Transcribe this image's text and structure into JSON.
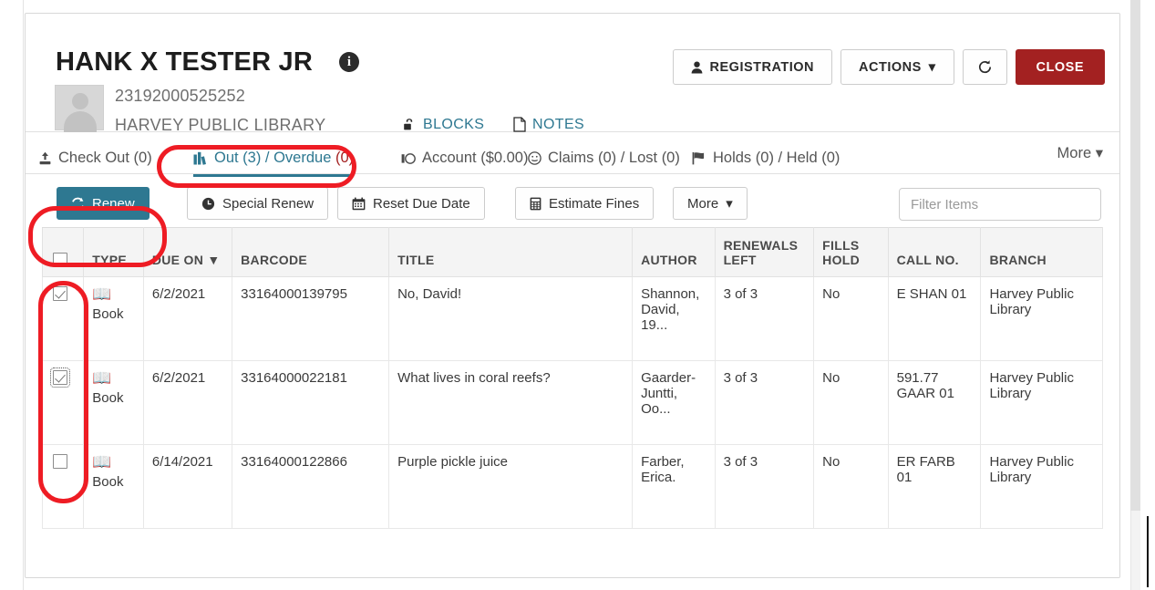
{
  "patron": {
    "name": "HANK X TESTER JR",
    "info_icon": "info-icon",
    "info_glyph": "i",
    "barcode": "23192000525252",
    "library": "HARVEY PUBLIC LIBRARY",
    "blocks_label": "BLOCKS",
    "notes_label": "NOTES"
  },
  "header_buttons": {
    "registration": "REGISTRATION",
    "actions": "ACTIONS",
    "actions_caret": "▾",
    "refresh_icon": "refresh-icon",
    "close": "CLOSE"
  },
  "tabs": [
    {
      "label": "Check Out (0)",
      "icon": "check-out-icon",
      "active": false
    },
    {
      "label": "Out (3) / Overdue (0)",
      "prefix": "Out (3) / Overdue ",
      "suffix": "(0)",
      "icon": "books-icon",
      "active": true
    },
    {
      "label": "Account ($0.00)",
      "icon": "coin-icon",
      "active": false
    },
    {
      "label": "Claims (0) / Lost (0)",
      "icon": "face-icon",
      "active": false
    },
    {
      "label": "Holds (0) / Held (0)",
      "icon": "flag-icon",
      "active": false
    }
  ],
  "tab_more": "More ▾",
  "toolbar": {
    "renew": "Renew",
    "special_renew": "Special Renew",
    "reset_due_date": "Reset Due Date",
    "estimate_fines": "Estimate Fines",
    "more": "More",
    "more_caret": "▾",
    "filter_placeholder": "Filter Items",
    "filter_value": ""
  },
  "table": {
    "columns": [
      {
        "key": "select",
        "label": "",
        "header_checkbox": true
      },
      {
        "key": "type",
        "label": "TYPE"
      },
      {
        "key": "due_on",
        "label": "DUE ON",
        "sorted": true,
        "sort_arrow": "▼"
      },
      {
        "key": "barcode",
        "label": "BARCODE"
      },
      {
        "key": "title",
        "label": "TITLE"
      },
      {
        "key": "author",
        "label": "AUTHOR"
      },
      {
        "key": "renewals",
        "label": "RENEWALS LEFT"
      },
      {
        "key": "fills",
        "label": "FILLS HOLD"
      },
      {
        "key": "callno",
        "label": "CALL NO."
      },
      {
        "key": "branch",
        "label": "BRANCH"
      }
    ],
    "rows": [
      {
        "checked": true,
        "focused": false,
        "type": "Book",
        "type_icon": "book-icon",
        "due_on": "6/2/2021",
        "barcode": "33164000139795",
        "title": "No, David!",
        "author": "Shannon, David, 19...",
        "renewals": "3 of 3",
        "fills": "No",
        "callno": "E SHAN 01",
        "branch": "Harvey Public Library"
      },
      {
        "checked": true,
        "focused": true,
        "type": "Book",
        "type_icon": "book-icon",
        "due_on": "6/2/2021",
        "barcode": "33164000022181",
        "title": "What lives in coral reefs?",
        "author": "Gaarder-Juntti, Oo...",
        "renewals": "3 of 3",
        "fills": "No",
        "callno": "591.77 GAAR 01",
        "branch": "Harvey Public Library"
      },
      {
        "checked": false,
        "focused": false,
        "type": "Book",
        "type_icon": "book-icon",
        "due_on": "6/14/2021",
        "barcode": "33164000122866",
        "title": "Purple pickle juice",
        "author": "Farber, Erica.",
        "renewals": "3 of 3",
        "fills": "No",
        "callno": "ER FARB 01",
        "branch": "Harvey Public Library"
      }
    ]
  },
  "annotations": [
    {
      "name": "highlight-out-overdue-tab",
      "color": "#ee1c24"
    },
    {
      "name": "highlight-renew-button",
      "color": "#ee1c24"
    },
    {
      "name": "highlight-checkbox-column",
      "color": "#ee1c24"
    }
  ],
  "colors": {
    "accent": "#2e7891",
    "danger": "#a32121",
    "annotation": "#ee1c24",
    "header_bg": "#f4f4f4"
  }
}
